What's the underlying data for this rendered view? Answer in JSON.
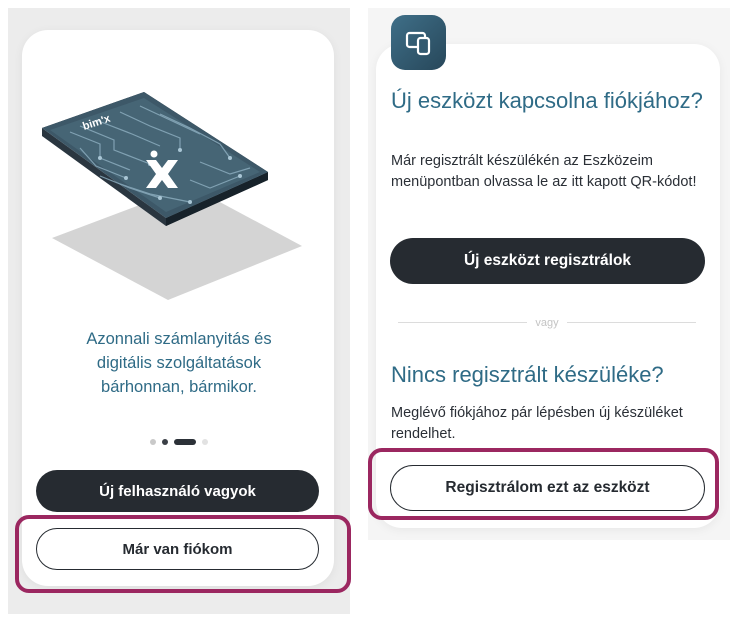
{
  "left": {
    "logo_text": "bim'x",
    "promo_text": "Azonnali számlanyitás és\ndigitális szolgáltatások\nbárhonnan, bármikor.",
    "new_user_button": "Új felhasználó vagyok",
    "have_account_button": "Már van fiókom",
    "pager": {
      "total": 4,
      "active_index": 2
    }
  },
  "right": {
    "heading1": "Új eszközt kapcsolna fiókjához?",
    "text1": "Már regisztrált készülékén az Eszközeim menüpontban olvassa le az itt kapott QR-kódot!",
    "register_new_device_button": "Új eszközt regisztrálok",
    "divider_text": "vagy",
    "heading2": "Nincs regisztrált készüléke?",
    "text2": "Meglévő fiókjához pár lépésben új készüléket rendelhet.",
    "register_this_device_button": "Regisztrálom ezt az eszközt"
  },
  "colors": {
    "accent_teal": "#2f6b86",
    "button_dark": "#262b31",
    "highlight_magenta": "#9b2760",
    "panel_bg_left": "#ececec",
    "panel_bg_right": "#f5f5f5"
  },
  "icons": {
    "device_badge": "devices-icon",
    "phone_illustration": "phone-illustration"
  }
}
